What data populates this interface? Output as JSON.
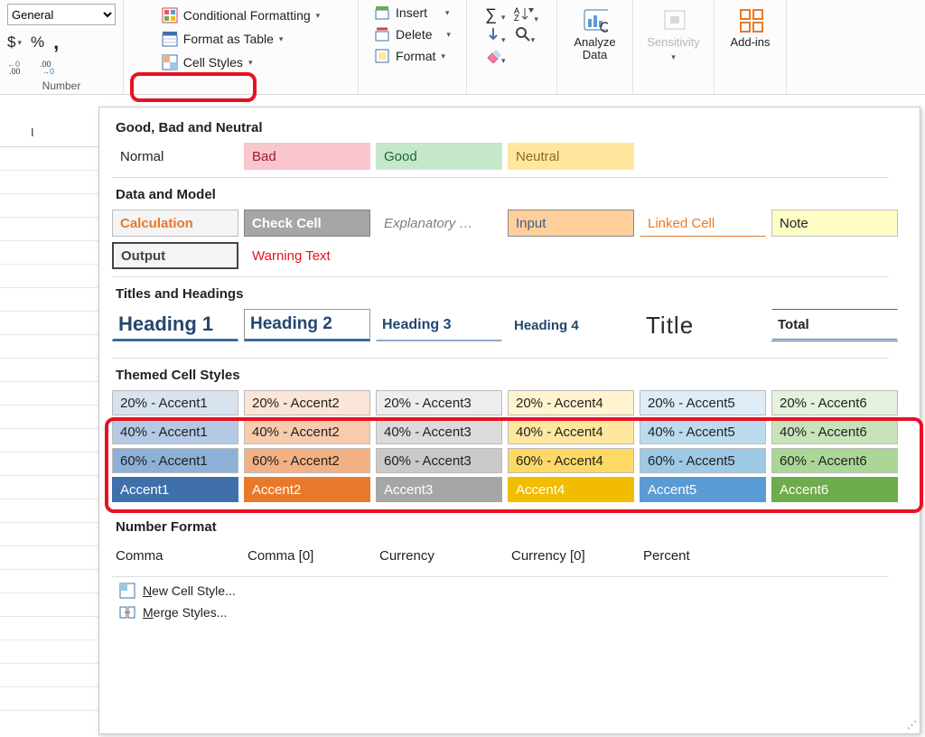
{
  "ribbon": {
    "number_format_selected": "General",
    "currency": "$",
    "percent": "%",
    "comma": ",",
    "inc_dec": {
      "inc": "←0 .00",
      "dec": ".00 →0"
    },
    "group_label": "Number",
    "styles": {
      "conditional": "Conditional Formatting",
      "format_table": "Format as Table",
      "cell_styles": "Cell Styles"
    },
    "cells": {
      "insert": "Insert",
      "delete": "Delete",
      "format": "Format"
    },
    "analyze": "Analyze Data",
    "sensitivity": "Sensitivity",
    "addins": "Add-ins"
  },
  "sheet": {
    "col_label": "I"
  },
  "panel": {
    "sections": {
      "gbn": "Good, Bad and Neutral",
      "dm": "Data and Model",
      "th": "Titles and Headings",
      "tc": "Themed Cell Styles",
      "nf": "Number Format"
    },
    "gbn": {
      "normal": "Normal",
      "bad": "Bad",
      "good": "Good",
      "neutral": "Neutral"
    },
    "dm": {
      "calculation": "Calculation",
      "check": "Check Cell",
      "explanatory": "Explanatory …",
      "input": "Input",
      "linked": "Linked Cell",
      "note": "Note",
      "output": "Output",
      "warning": "Warning Text"
    },
    "th": {
      "h1": "Heading 1",
      "h2": "Heading 2",
      "h3": "Heading 3",
      "h4": "Heading 4",
      "title": "Title",
      "total": "Total"
    },
    "accents": {
      "rows": [
        "20%",
        "40%",
        "60%"
      ],
      "labels": [
        [
          "20% - Accent1",
          "20% - Accent2",
          "20% - Accent3",
          "20% - Accent4",
          "20% - Accent5",
          "20% - Accent6"
        ],
        [
          "40% - Accent1",
          "40% - Accent2",
          "40% - Accent3",
          "40% - Accent4",
          "40% - Accent5",
          "40% - Accent6"
        ],
        [
          "60% - Accent1",
          "60% - Accent2",
          "60% - Accent3",
          "60% - Accent4",
          "60% - Accent5",
          "60% - Accent6"
        ],
        [
          "Accent1",
          "Accent2",
          "Accent3",
          "Accent4",
          "Accent5",
          "Accent6"
        ]
      ],
      "colors": [
        [
          "#d8e3f0",
          "#fbe5d6",
          "#ededed",
          "#fff4cf",
          "#deecf7",
          "#e4f1dd"
        ],
        [
          "#b4c9e4",
          "#f7cbac",
          "#dbdbdb",
          "#ffe79f",
          "#bcdcee",
          "#c8e3b9"
        ],
        [
          "#8db0d8",
          "#f3b183",
          "#c9c9c9",
          "#ffd966",
          "#9cc9e6",
          "#abd796"
        ],
        [
          "#3f70ac",
          "#e9792a",
          "#a6a6a6",
          "#f2bc00",
          "#5b9bd5",
          "#6eab4a"
        ]
      ]
    },
    "nf": {
      "comma": "Comma",
      "comma0": "Comma [0]",
      "currency": "Currency",
      "currency0": "Currency [0]",
      "percent": "Percent"
    },
    "footer": {
      "new_style": "New Cell Style...",
      "merge": "Merge Styles..."
    }
  }
}
